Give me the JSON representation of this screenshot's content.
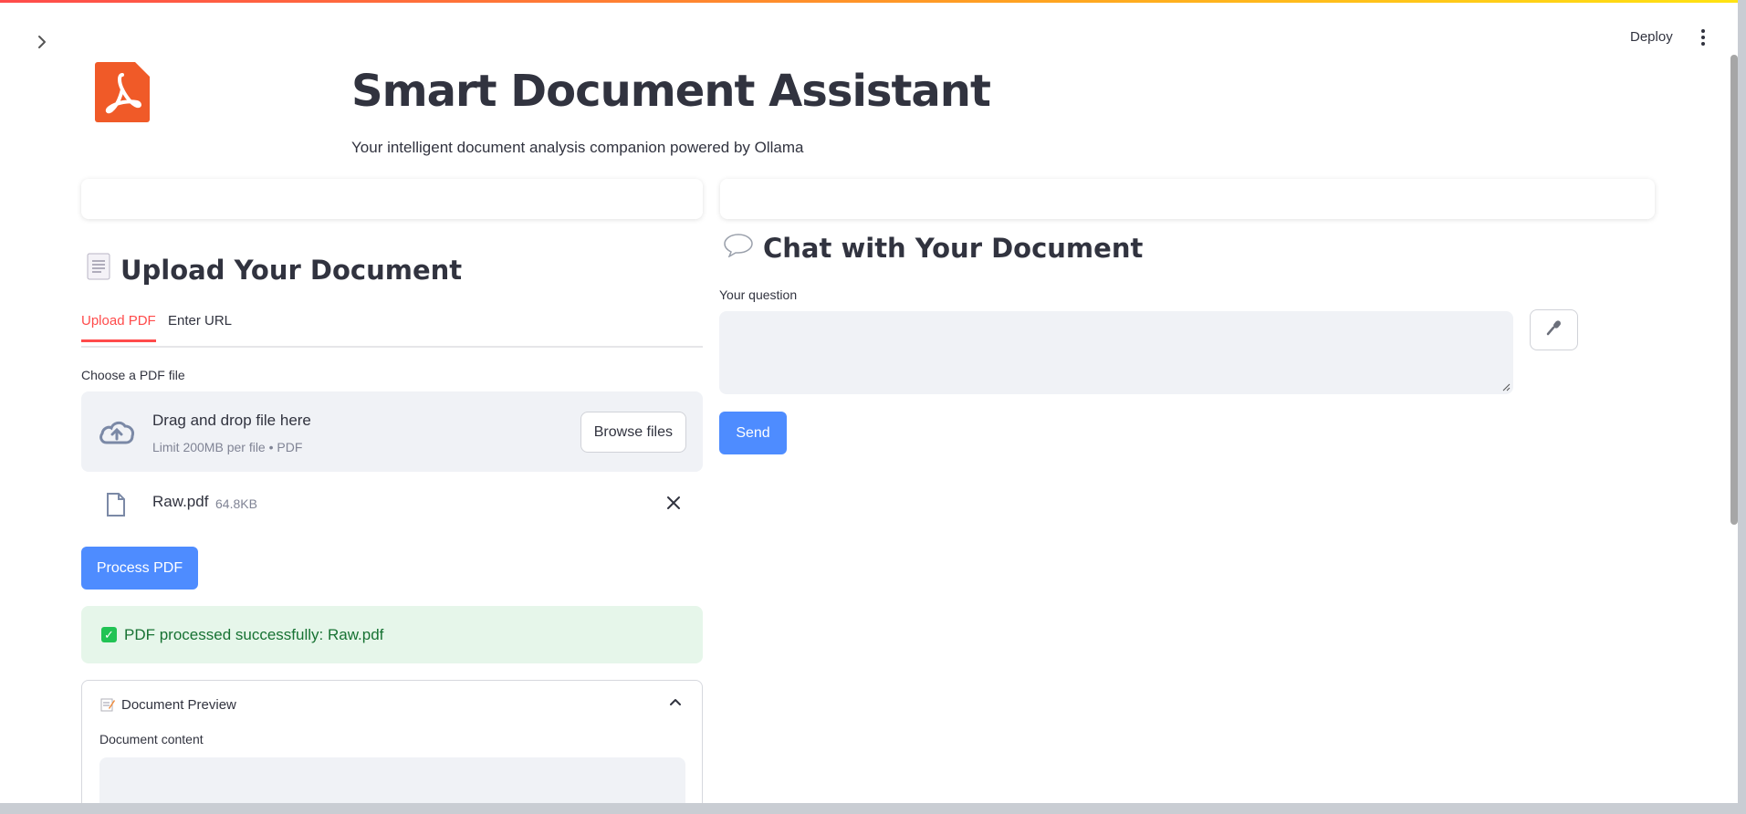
{
  "header": {
    "deploy_label": "Deploy",
    "menu_icon": "kebab-menu-icon",
    "sidebar_toggle_icon": "chevron-right-icon"
  },
  "app": {
    "logo_icon": "pdf-logo-icon",
    "title": "Smart Document Assistant",
    "subtitle": "Your intelligent document analysis companion powered by Ollama"
  },
  "upload_section": {
    "title": "Upload Your Document",
    "icon": "document-icon",
    "tabs": [
      {
        "label": "Upload PDF",
        "active": true
      },
      {
        "label": "Enter URL",
        "active": false
      }
    ],
    "file_label": "Choose a PDF file",
    "dropzone": {
      "icon": "cloud-upload-icon",
      "title": "Drag and drop file here",
      "limit": "Limit 200MB per file • PDF",
      "browse_label": "Browse files"
    },
    "uploaded_file": {
      "name": "Raw.pdf",
      "size": "64.8KB",
      "icon": "file-icon",
      "remove_icon": "close-icon"
    },
    "process_button": "Process PDF",
    "success_message": "PDF processed successfully: Raw.pdf",
    "preview": {
      "icon": "memo-icon",
      "title": "Document Preview",
      "content_label": "Document content",
      "toggle_icon": "chevron-up-icon"
    }
  },
  "chat_section": {
    "title": "Chat with Your Document",
    "icon": "speech-bubble-icon",
    "question_label": "Your question",
    "question_value": "",
    "mic_icon": "microphone-icon",
    "send_button": "Send"
  },
  "colors": {
    "accent": "#ff4b4b",
    "primary_button": "#4e8cff",
    "success_bg": "#e6f6ea",
    "success_text": "#177233",
    "logo": "#f05a28"
  }
}
